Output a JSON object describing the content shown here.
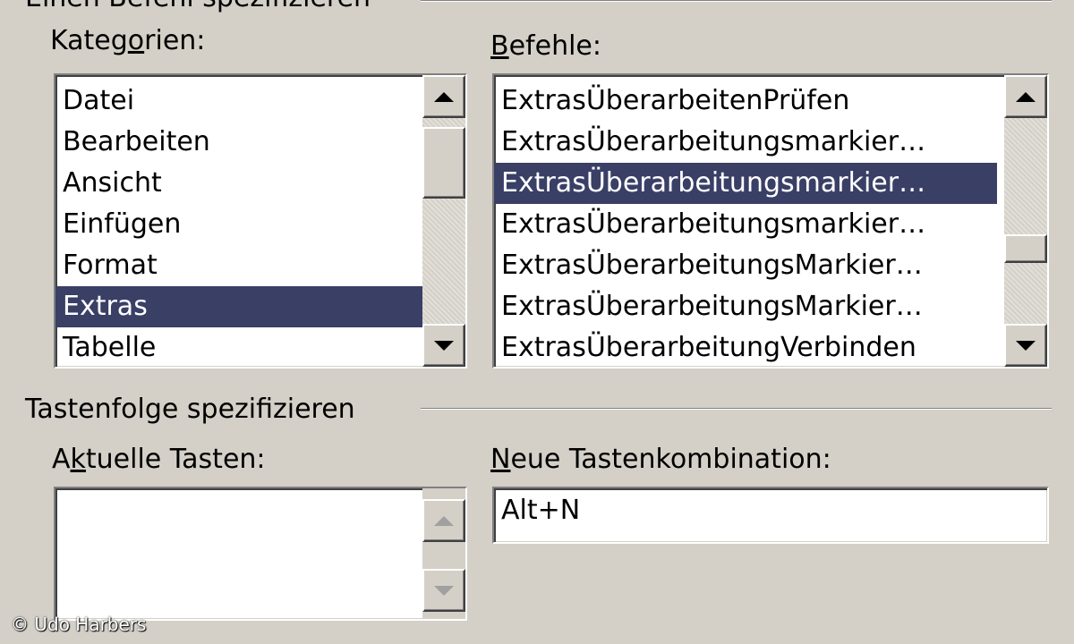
{
  "group_specify_command": {
    "title": "Einen Befehl spezifizieren"
  },
  "categories": {
    "label_pre": "Kateg",
    "label_accel": "o",
    "label_post": "rien:",
    "items": [
      "Datei",
      "Bearbeiten",
      "Ansicht",
      "Einfügen",
      "Format",
      "Extras",
      "Tabelle"
    ],
    "selected_index": 5
  },
  "commands": {
    "label_pre": "",
    "label_accel": "B",
    "label_post": "efehle:",
    "items": [
      "ExtrasÜberarbeitenPrüfen",
      "ExtrasÜberarbeitungsmarkier…",
      "ExtrasÜberarbeitungsmarkier…",
      "ExtrasÜberarbeitungsmarkier…",
      "ExtrasÜberarbeitungsMarkier…",
      "ExtrasÜberarbeitungsMarkier…",
      "ExtrasÜberarbeitungVerbinden"
    ],
    "selected_index": 2
  },
  "group_keys": {
    "title": "Tastenfolge spezifizieren"
  },
  "current_keys": {
    "label_pre": "A",
    "label_accel": "k",
    "label_post": "tuelle Tasten:",
    "items": []
  },
  "new_shortcut": {
    "label_pre": "",
    "label_accel": "N",
    "label_post": "eue Tastenkombination:",
    "value": "Alt+N"
  },
  "colors": {
    "dialog_bg": "#d4d0c8",
    "selection_bg": "#3a3f66",
    "selection_text": "#ffffff"
  },
  "icons": {
    "scroll_up": "triangle-up",
    "scroll_down": "triangle-down"
  },
  "watermark": "© Udo Harbers"
}
